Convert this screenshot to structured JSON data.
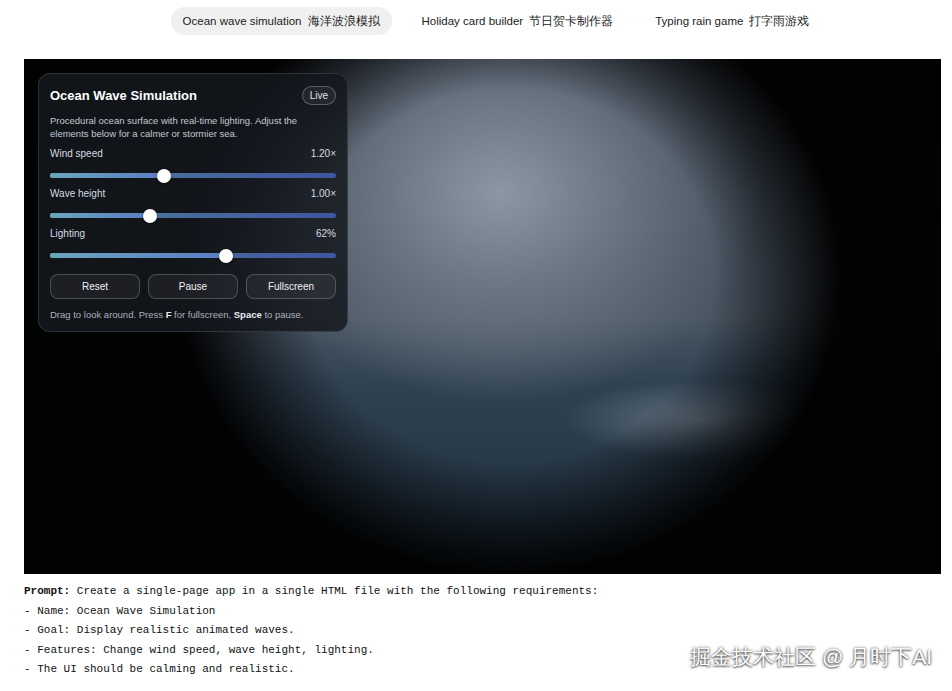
{
  "tabs": [
    {
      "label": "Ocean wave simulation",
      "label_cn": "海洋波浪模拟",
      "selected": true
    },
    {
      "label": "Holiday card builder",
      "label_cn": "节日贺卡制作器",
      "selected": false
    },
    {
      "label": "Typing rain game",
      "label_cn": "打字雨游戏",
      "selected": false
    }
  ],
  "panel": {
    "title": "Ocean Wave Simulation",
    "badge": "Live",
    "description": "Procedural ocean surface with real-time lighting. Adjust the elements below for a calmer or stormier sea.",
    "sliders": [
      {
        "label": "Wind speed",
        "reading": "1.20×",
        "level": 0.4
      },
      {
        "label": "Wave height",
        "reading": "1.00×",
        "level": 0.35
      },
      {
        "label": "Lighting",
        "reading": "62%",
        "level": 0.615
      }
    ],
    "buttons": [
      "Reset",
      "Pause",
      "Fullscreen"
    ],
    "hint": [
      {
        "text": "Drag to look around. Press ",
        "bold": false
      },
      {
        "text": "F",
        "bold": true
      },
      {
        "text": " for fullscreen, ",
        "bold": false
      },
      {
        "text": "Space",
        "bold": true
      },
      {
        "text": " to pause.",
        "bold": false
      }
    ]
  },
  "prompt": {
    "label": "Prompt:",
    "lines": [
      "Create a single-page app in a single HTML file with the following requirements:",
      "- Name: Ocean Wave Simulation",
      "- Goal: Display realistic animated waves.",
      "- Features: Change wind speed, wave height, lighting.",
      "- The UI should be calming and realistic."
    ]
  },
  "watermark": "掘金技术社区 @ 月时下AI"
}
